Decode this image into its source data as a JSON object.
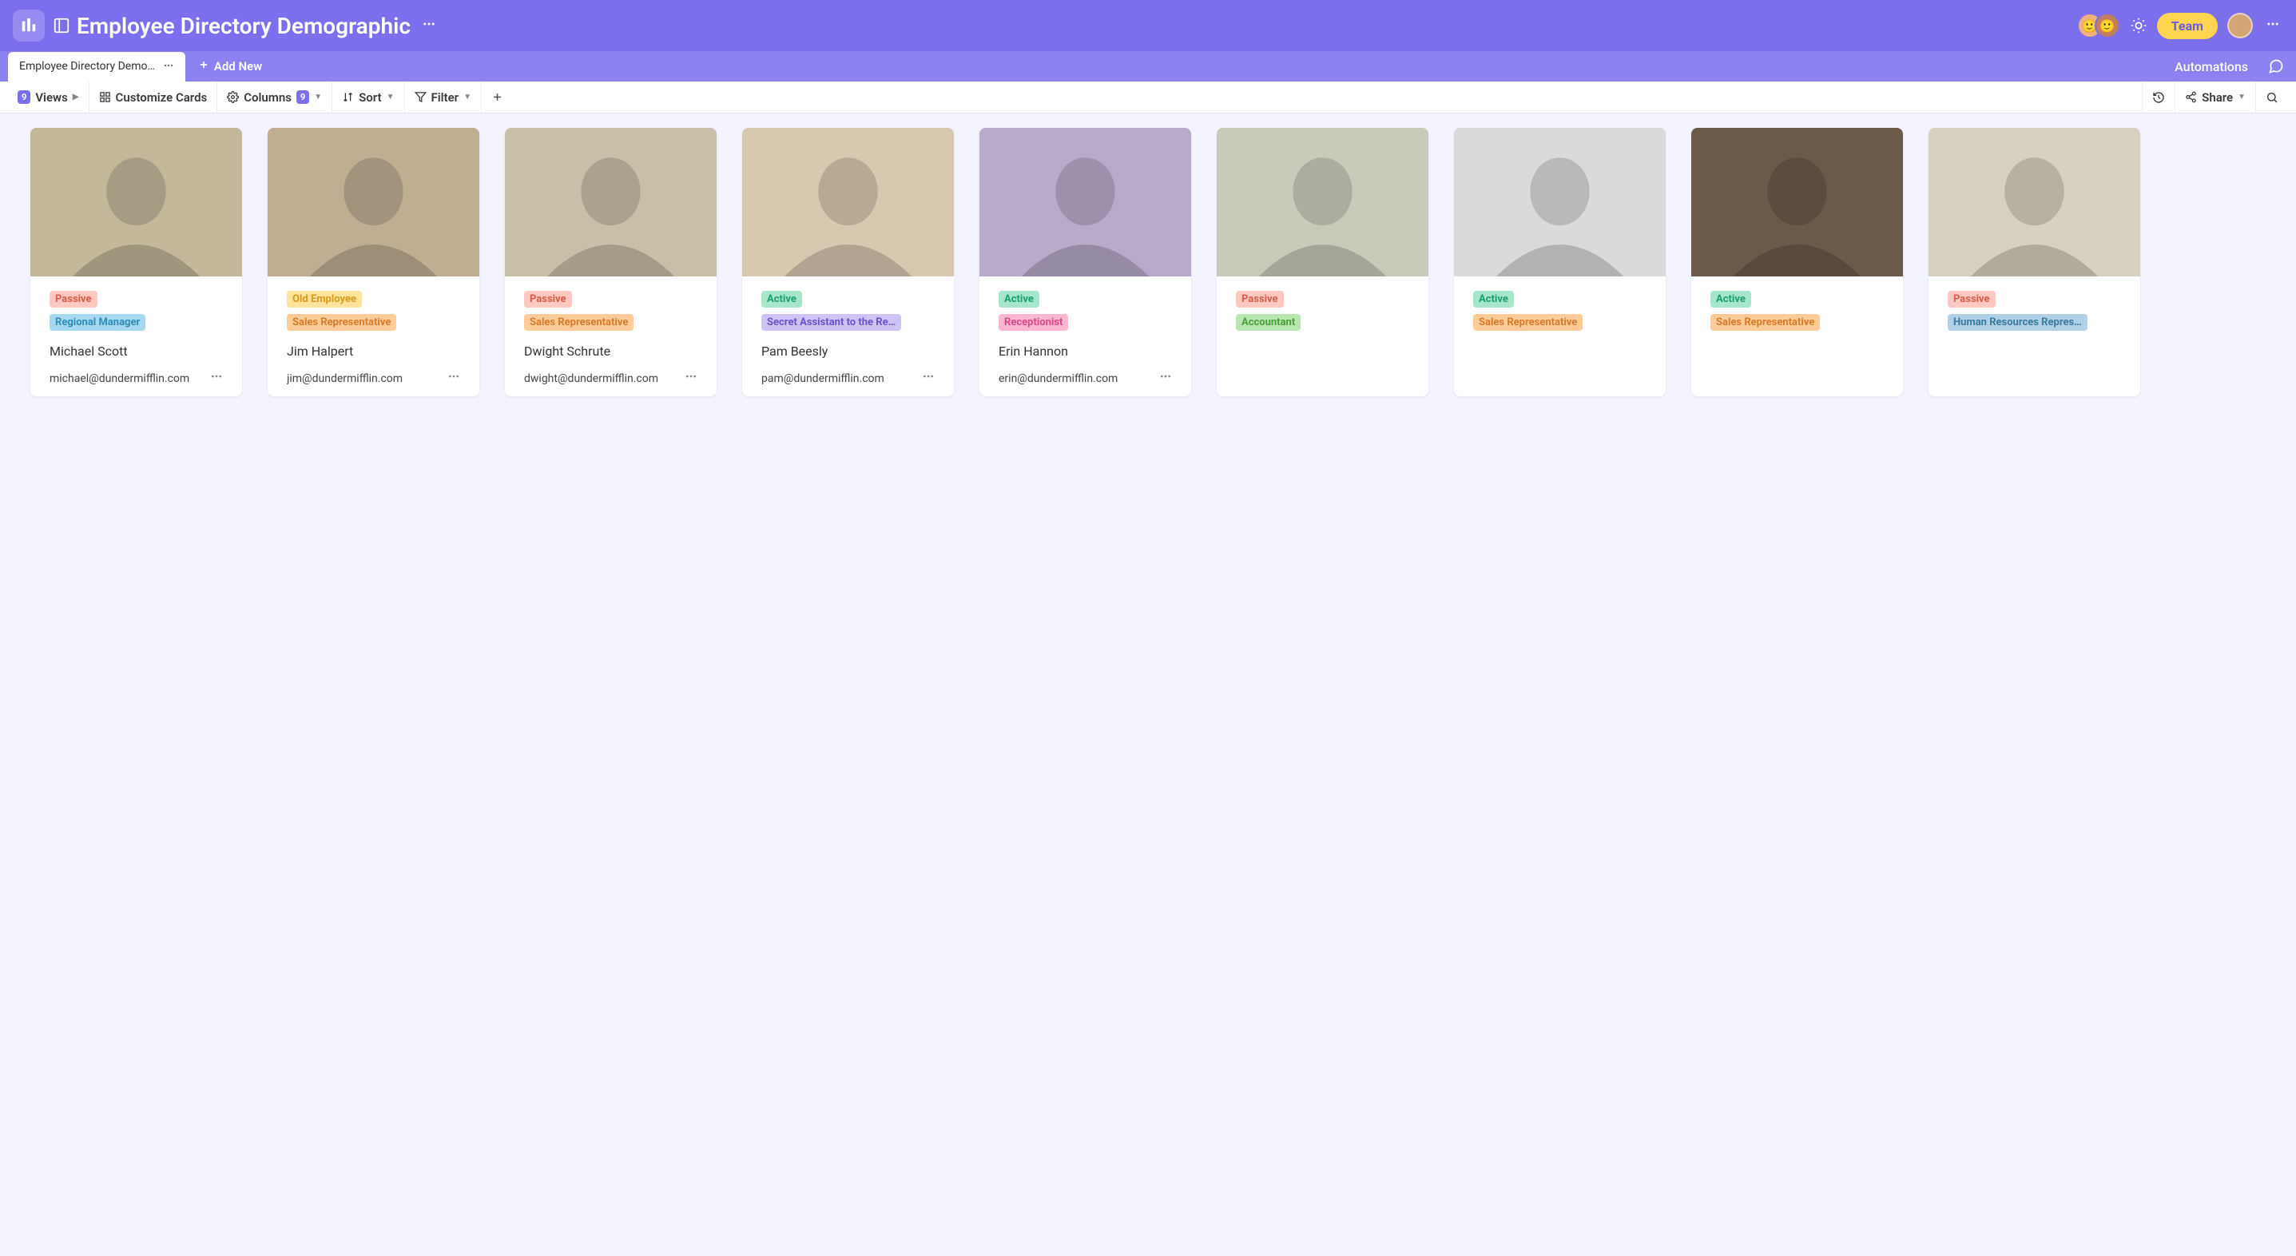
{
  "header": {
    "title": "Employee Directory Demographic",
    "team_button": "Team"
  },
  "subheader": {
    "tab_label": "Employee Directory Demo…",
    "add_new": "Add New",
    "automations": "Automations"
  },
  "toolbar": {
    "views": {
      "label": "Views",
      "count": "9"
    },
    "customize": "Customize Cards",
    "columns": {
      "label": "Columns",
      "count": "9"
    },
    "sort": "Sort",
    "filter": "Filter",
    "share": "Share"
  },
  "tag_styles": {
    "Passive": {
      "bg": "#ffc9c1",
      "fg": "#d95b4a"
    },
    "Active": {
      "bg": "#a6e7cc",
      "fg": "#1a9e6f"
    },
    "Old Employee": {
      "bg": "#ffe29b",
      "fg": "#d69a1e"
    },
    "Regional Manager": {
      "bg": "#a6d8f0",
      "fg": "#2c8db8"
    },
    "Sales Representative": {
      "bg": "#ffcc99",
      "fg": "#d67a2c"
    },
    "Secret Assistant to the Re…": {
      "bg": "#cfc2f5",
      "fg": "#6a52c9"
    },
    "Receptionist": {
      "bg": "#ffb6d0",
      "fg": "#d64a87"
    },
    "Accountant": {
      "bg": "#b8e6b0",
      "fg": "#4a9e3a"
    },
    "Human Resources Repres…": {
      "bg": "#b0d0e6",
      "fg": "#3a7a9e"
    }
  },
  "cards": [
    {
      "name": "Michael Scott",
      "email": "michael@dundermifflin.com",
      "status": "Passive",
      "role": "Regional Manager",
      "bg": "#c4b89a"
    },
    {
      "name": "Jim Halpert",
      "email": "jim@dundermifflin.com",
      "status": "Old Employee",
      "role": "Sales Representative",
      "bg": "#bfae92"
    },
    {
      "name": "Dwight Schrute",
      "email": "dwight@dundermifflin.com",
      "status": "Passive",
      "role": "Sales Representative",
      "bg": "#c8bfa8"
    },
    {
      "name": "Pam Beesly",
      "email": "pam@dundermifflin.com",
      "status": "Active",
      "role": "Secret Assistant to the Re…",
      "bg": "#d8c8b0"
    },
    {
      "name": "Erin Hannon",
      "email": "erin@dundermifflin.com",
      "status": "Active",
      "role": "Receptionist",
      "bg": "#b8aaca"
    },
    {
      "name": "",
      "email": "",
      "status": "Passive",
      "role": "Accountant",
      "bg": "#cacabb",
      "partial": true
    },
    {
      "name": "",
      "email": "",
      "status": "Active",
      "role": "Sales Representative",
      "bg": "#dadada",
      "partial": true
    },
    {
      "name": "",
      "email": "",
      "status": "Active",
      "role": "Sales Representative",
      "bg": "#6b5a4a",
      "partial": true
    },
    {
      "name": "",
      "email": "",
      "status": "Passive",
      "role": "Human Resources Repres…",
      "bg": "#d8d0c0",
      "partial": true
    }
  ]
}
